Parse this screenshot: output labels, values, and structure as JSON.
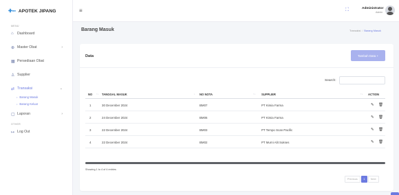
{
  "app": {
    "brand": "APOTEK JIPANG",
    "logo_icon": "pharmacy-logo-icon"
  },
  "sidebar": {
    "menu_label": "MENU",
    "other_label": "OTHER",
    "items": [
      {
        "label": "Dashboard",
        "icon": "home-icon"
      },
      {
        "label": "Master Obat",
        "icon": "pill-icon"
      },
      {
        "label": "Persediaan Obat",
        "icon": "box-icon"
      },
      {
        "label": "Supplier",
        "icon": "user-icon"
      },
      {
        "label": "Transaksi",
        "icon": "exchange-icon"
      },
      {
        "label": "Laporan",
        "icon": "file-icon"
      }
    ],
    "sub_items": [
      "Barang Masuk",
      "Barang Keluar"
    ],
    "logout": "Log Out"
  },
  "topbar": {
    "user_name": "Administrator",
    "user_role": "Admin"
  },
  "page": {
    "title": "Barang Masuk",
    "breadcrumb": [
      "Transaksi",
      "Barang Masuk"
    ]
  },
  "card": {
    "title": "Data",
    "add_button": "Tambah Data +",
    "search_label": "Search:",
    "search_value": ""
  },
  "table": {
    "columns": [
      "NO",
      "TANGGAL MASUK",
      "NO NOTA",
      "SUPPLIER",
      "ACTION"
    ],
    "rows": [
      {
        "no": "1",
        "tanggal": "30 December 2024",
        "nota": "BM07",
        "supplier": "PT Kimia Farma"
      },
      {
        "no": "2",
        "tanggal": "24 December 2024",
        "nota": "BM06",
        "supplier": "PT Kimia Farma"
      },
      {
        "no": "3",
        "tanggal": "22 December 2024",
        "nota": "BM03",
        "supplier": "PT Tempo Scan Pacific"
      },
      {
        "no": "4",
        "tanggal": "22 December 2024",
        "nota": "BM02",
        "supplier": "PT Murni Alit Sukses"
      }
    ],
    "info": "Showing 1 to 4 of 4 entries",
    "pagination": {
      "previous": "Previous",
      "current": "1",
      "next": "Next"
    }
  },
  "colors": {
    "accent": "#6c7ae0",
    "edit": "#2eb872",
    "delete": "#e04848"
  }
}
